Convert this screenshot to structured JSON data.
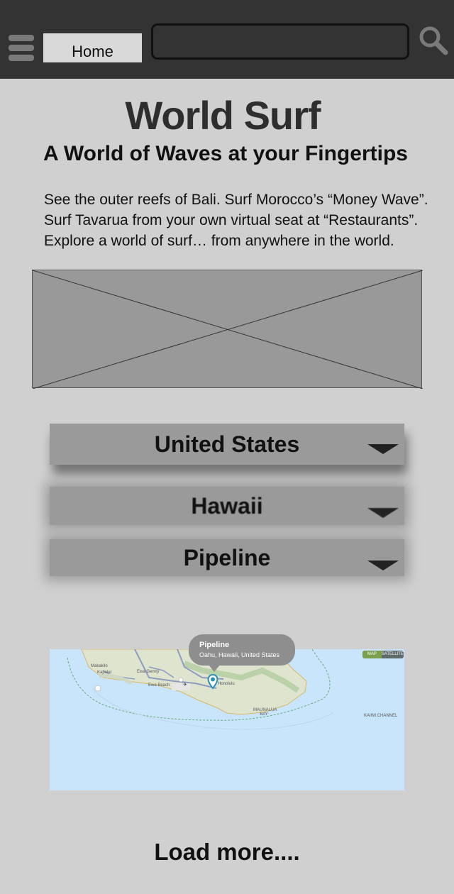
{
  "header": {
    "home_label": "Home",
    "search": {
      "value": "",
      "placeholder": ""
    }
  },
  "hero": {
    "title": "World Surf",
    "subtitle": "A World of Waves at your Fingertips",
    "intro_lines": [
      "See the outer reefs of Bali. Surf Morocco’s “Money Wave”.",
      "Surf Tavarua from your own virtual seat at “Restaurants”.",
      "Explore a world of surf… from anywhere in the world."
    ]
  },
  "filters": {
    "country": "United States",
    "region": "Hawaii",
    "spot": "Pipeline"
  },
  "map": {
    "callout_name": "Pipeline",
    "callout_location": "Oahu, Hawaii, United States",
    "toggle_map": "MAP",
    "toggle_satellite": "SATELLITE",
    "place_labels": [
      "Makakilo",
      "Kapolei",
      "Ewa Beach",
      "Ewa Gentry",
      "Honolulu",
      "MAUNALUA BAY",
      "KAIWI CHANNEL"
    ]
  },
  "footer": {
    "load_more": "Load more...."
  },
  "colors": {
    "topbar": "#333333",
    "page_background": "#d0d0d0",
    "placeholder_image": "#999999",
    "select_box": "#9a9a9a",
    "ocean": "#c9e5fb"
  }
}
